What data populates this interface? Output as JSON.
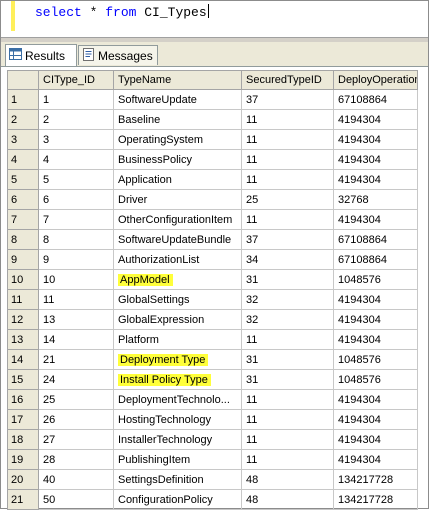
{
  "editor": {
    "keyword_select": "select",
    "star": " * ",
    "keyword_from": "from",
    "table_name": " CI_Types"
  },
  "tabs": [
    {
      "label": "Results",
      "icon": "grid-icon",
      "active": true
    },
    {
      "label": "Messages",
      "icon": "messages-icon",
      "active": false
    }
  ],
  "grid": {
    "columns": [
      "CIType_ID",
      "TypeName",
      "SecuredTypeID",
      "DeployOperation"
    ],
    "highlight_color": "#ffff3a",
    "rows": [
      {
        "n": "1",
        "id": "1",
        "name": "SoftwareUpdate",
        "sec": "37",
        "dep": "67108864",
        "hl": false
      },
      {
        "n": "2",
        "id": "2",
        "name": "Baseline",
        "sec": "11",
        "dep": "4194304",
        "hl": false
      },
      {
        "n": "3",
        "id": "3",
        "name": "OperatingSystem",
        "sec": "11",
        "dep": "4194304",
        "hl": false
      },
      {
        "n": "4",
        "id": "4",
        "name": "BusinessPolicy",
        "sec": "11",
        "dep": "4194304",
        "hl": false
      },
      {
        "n": "5",
        "id": "5",
        "name": "Application",
        "sec": "11",
        "dep": "4194304",
        "hl": false
      },
      {
        "n": "6",
        "id": "6",
        "name": "Driver",
        "sec": "25",
        "dep": "32768",
        "hl": false
      },
      {
        "n": "7",
        "id": "7",
        "name": "OtherConfigurationItem",
        "sec": "11",
        "dep": "4194304",
        "hl": false
      },
      {
        "n": "8",
        "id": "8",
        "name": "SoftwareUpdateBundle",
        "sec": "37",
        "dep": "67108864",
        "hl": false
      },
      {
        "n": "9",
        "id": "9",
        "name": "AuthorizationList",
        "sec": "34",
        "dep": "67108864",
        "hl": false
      },
      {
        "n": "10",
        "id": "10",
        "name": "AppModel",
        "sec": "31",
        "dep": "1048576",
        "hl": true
      },
      {
        "n": "11",
        "id": "11",
        "name": "GlobalSettings",
        "sec": "32",
        "dep": "4194304",
        "hl": false
      },
      {
        "n": "12",
        "id": "13",
        "name": "GlobalExpression",
        "sec": "32",
        "dep": "4194304",
        "hl": false
      },
      {
        "n": "13",
        "id": "14",
        "name": "Platform",
        "sec": "11",
        "dep": "4194304",
        "hl": false
      },
      {
        "n": "14",
        "id": "21",
        "name": "Deployment Type",
        "sec": "31",
        "dep": "1048576",
        "hl": true
      },
      {
        "n": "15",
        "id": "24",
        "name": "Install Policy Type",
        "sec": "31",
        "dep": "1048576",
        "hl": true
      },
      {
        "n": "16",
        "id": "25",
        "name": "DeploymentTechnolo...",
        "sec": "11",
        "dep": "4194304",
        "hl": false
      },
      {
        "n": "17",
        "id": "26",
        "name": "HostingTechnology",
        "sec": "11",
        "dep": "4194304",
        "hl": false
      },
      {
        "n": "18",
        "id": "27",
        "name": "InstallerTechnology",
        "sec": "11",
        "dep": "4194304",
        "hl": false
      },
      {
        "n": "19",
        "id": "28",
        "name": "PublishingItem",
        "sec": "11",
        "dep": "4194304",
        "hl": false
      },
      {
        "n": "20",
        "id": "40",
        "name": "SettingsDefinition",
        "sec": "48",
        "dep": "134217728",
        "hl": false
      },
      {
        "n": "21",
        "id": "50",
        "name": "ConfigurationPolicy",
        "sec": "48",
        "dep": "134217728",
        "hl": false
      }
    ]
  }
}
